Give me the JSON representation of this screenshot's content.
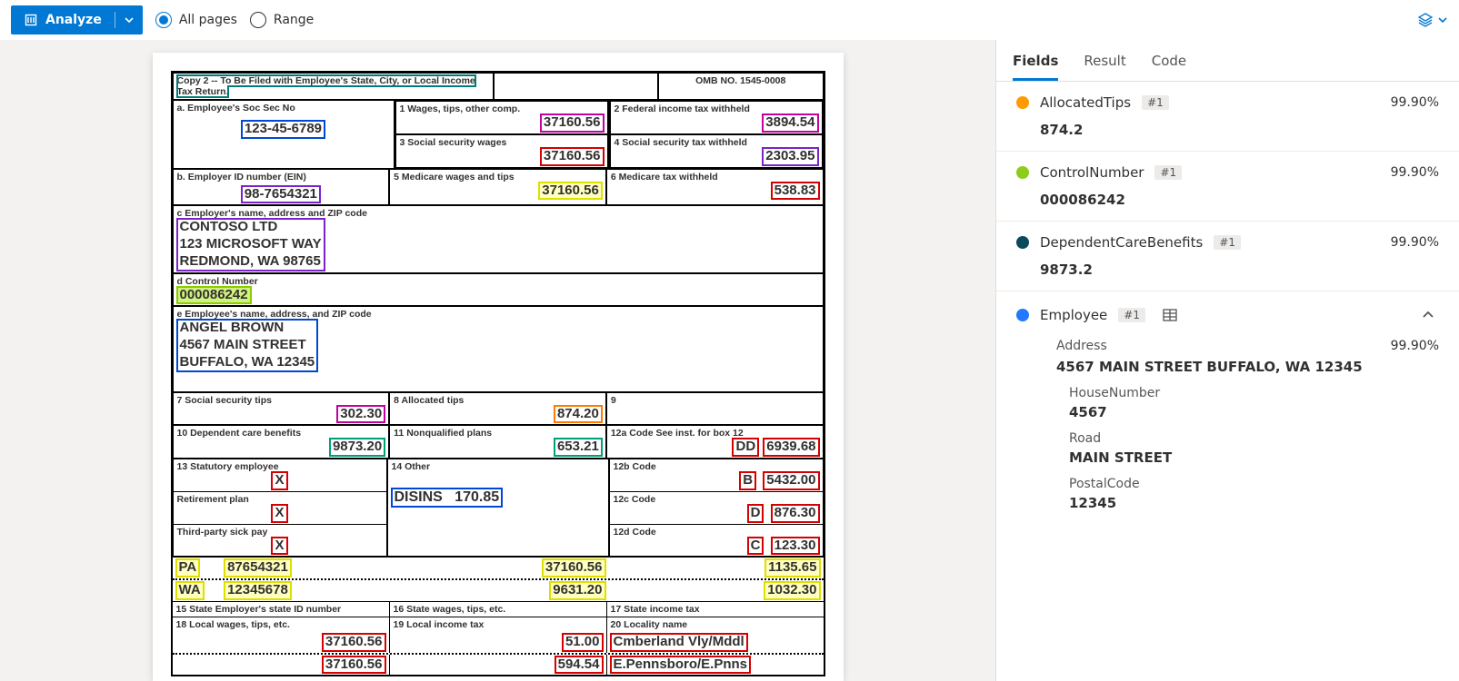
{
  "toolbar": {
    "analyze_label": "Analyze",
    "radio_allpages": "All pages",
    "radio_range": "Range"
  },
  "tabs": {
    "fields": "Fields",
    "result": "Result",
    "code": "Code"
  },
  "form": {
    "copy_line": "Copy 2 -- To Be Filed with Employee's State, City, or Local Income Tax Return.",
    "omb": "OMB NO. 1545-0008",
    "a_label": "a. Employee's Soc Sec No",
    "a_val": "123-45-6789",
    "b_label": "b. Employer ID number (EIN)",
    "b_val": "98-7654321",
    "c_label": "c Employer's name, address and ZIP code",
    "c_line1": "CONTOSO LTD",
    "c_line2": "123 MICROSOFT WAY",
    "c_line3": "REDMOND, WA 98765",
    "d_label": "d Control Number",
    "d_val": "000086242",
    "e_label": "e Employee's name, address, and ZIP code",
    "e_line1": "ANGEL BROWN",
    "e_line2": "4567 MAIN STREET",
    "e_line3": "BUFFALO, WA 12345",
    "box1_label": "1 Wages, tips, other comp.",
    "box1_val": "37160.56",
    "box2_label": "2 Federal income tax withheld",
    "box2_val": "3894.54",
    "box3_label": "3 Social security wages",
    "box3_val": "37160.56",
    "box4_label": "4 Social security tax withheld",
    "box4_val": "2303.95",
    "box5_label": "5 Medicare wages and tips",
    "box5_val": "37160.56",
    "box6_label": "6 Medicare tax withheld",
    "box6_val": "538.83",
    "box7_label": "7 Social security tips",
    "box7_val": "302.30",
    "box8_label": "8 Allocated tips",
    "box8_val": "874.20",
    "box9_label": "9",
    "box10_label": "10 Dependent care benefits",
    "box10_val": "9873.20",
    "box11_label": "11 Nonqualified plans",
    "box11_val": "653.21",
    "box12a_label": "12a Code See inst. for box 12",
    "box12a_code": "DD",
    "box12a_val": "6939.68",
    "box12b_label": "12b Code",
    "box12b_code": "B",
    "box12b_val": "5432.00",
    "box12c_label": "12c Code",
    "box12c_code": "D",
    "box12c_val": "876.30",
    "box12d_label": "12d Code",
    "box12d_code": "C",
    "box12d_val": "123.30",
    "box13_label": "13 Statutory employee",
    "box13_ret": "Retirement plan",
    "box13_sick": "Third-party sick pay",
    "box14_label": "14 Other",
    "box14_code": "DISINS",
    "box14_val": "170.85",
    "state1_st": "PA",
    "state1_id": "87654321",
    "state1_wages": "37160.56",
    "state1_tax": "1135.65",
    "state2_st": "WA",
    "state2_id": "12345678",
    "state2_wages": "9631.20",
    "state2_tax": "1032.30",
    "lbl15": "15 State Employer's state ID number",
    "lbl16": "16 State wages, tips, etc.",
    "lbl17": "17 State income tax",
    "lbl18": "18 Local wages, tips, etc.",
    "lbl19": "19 Local income tax",
    "lbl20": "20 Locality name",
    "local1_wages": "37160.56",
    "local1_tax": "51.00",
    "local1_name": "Cmberland Vly/Mddl",
    "local2_wages": "37160.56",
    "local2_tax": "594.54",
    "local2_name": "E.Pennsboro/E.Pnns",
    "X": "X"
  },
  "fields": {
    "allocatedtips": {
      "name": "AllocatedTips",
      "badge": "#1",
      "conf": "99.90%",
      "value": "874.2",
      "color": "#ff9a00"
    },
    "controlnumber": {
      "name": "ControlNumber",
      "badge": "#1",
      "conf": "99.90%",
      "value": "000086242",
      "color": "#8dcc1a"
    },
    "dependentcare": {
      "name": "DependentCareBenefits",
      "badge": "#1",
      "conf": "99.90%",
      "value": "9873.2",
      "color": "#0a4a5a"
    },
    "employee": {
      "name": "Employee",
      "badge": "#1",
      "color": "#2278ff",
      "address_label": "Address",
      "address_conf": "99.90%",
      "address_value": "4567 MAIN STREET BUFFALO, WA 12345",
      "house_label": "HouseNumber",
      "house_value": "4567",
      "road_label": "Road",
      "road_value": "MAIN STREET",
      "postal_label": "PostalCode",
      "postal_value": "12345"
    }
  }
}
